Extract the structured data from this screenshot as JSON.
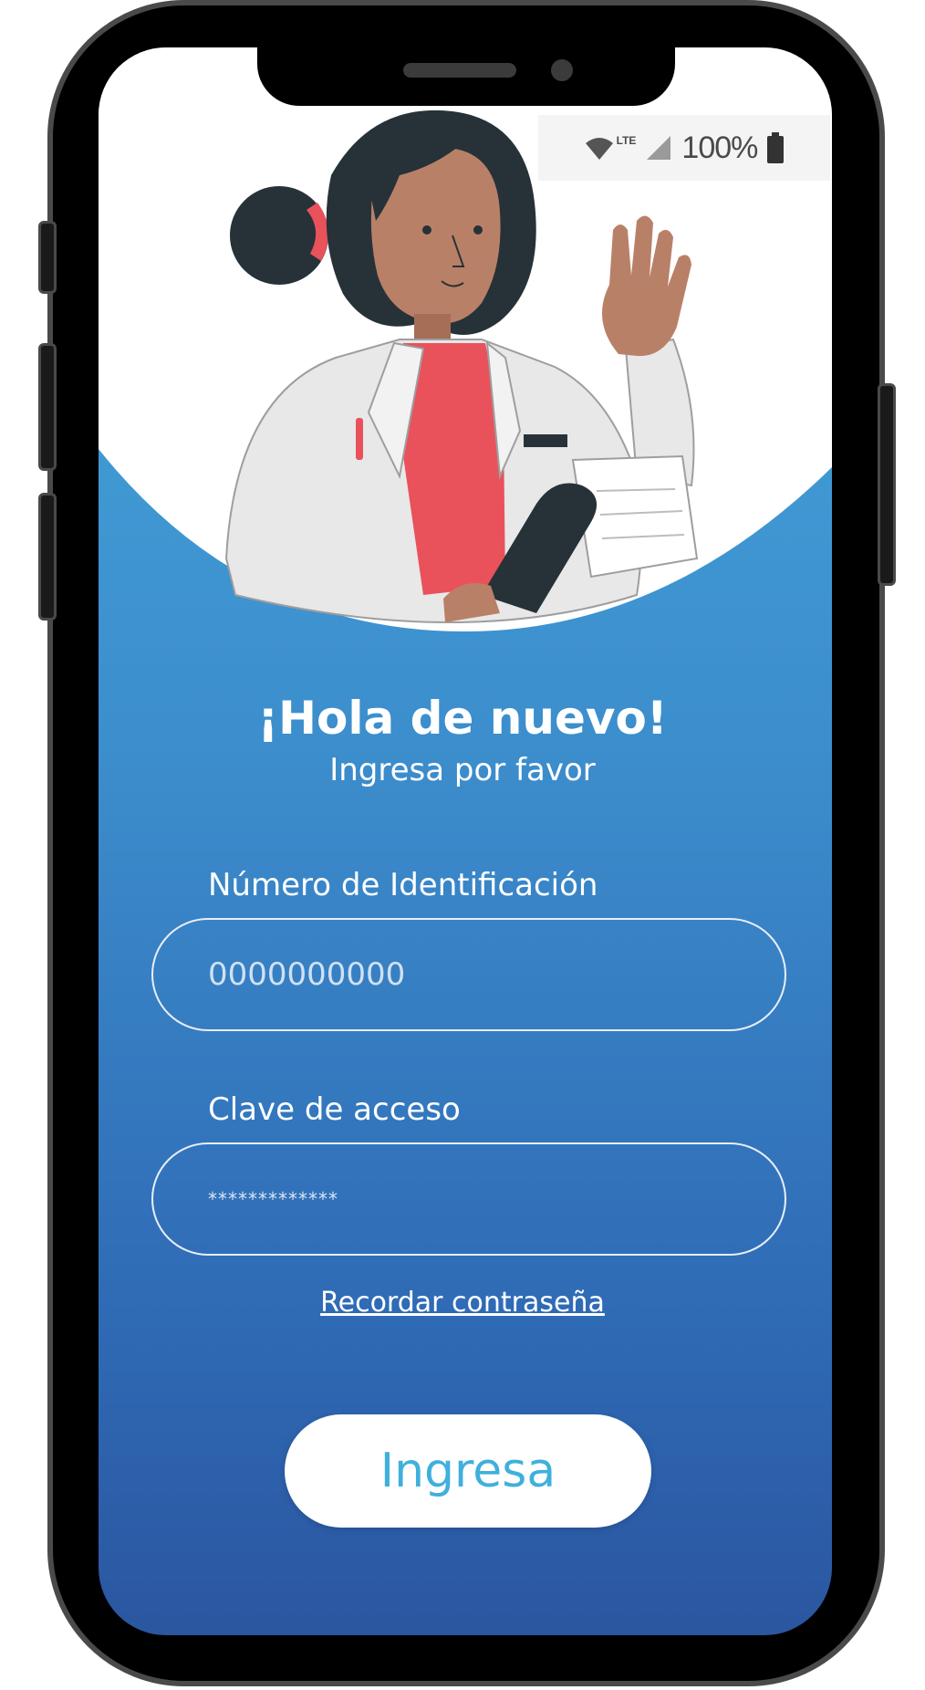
{
  "status_bar": {
    "network_label": "LTE",
    "battery_text": "100%"
  },
  "login": {
    "title": "¡Hola de nuevo!",
    "subtitle": "Ingresa por favor",
    "id_label": "Número de Identificación",
    "id_value": "0000000000",
    "password_label": "Clave de acceso",
    "password_value": "*************",
    "remember_link": "Recordar contraseña",
    "submit_label": "Ingresa"
  },
  "colors": {
    "gradient_top": "#45a8dc",
    "gradient_bottom": "#2b56a0",
    "button_text": "#3fb0dc",
    "shirt": "#e9525b",
    "hair": "#263238",
    "skin": "#b98068"
  },
  "icons": [
    "wifi-icon",
    "signal-icon",
    "battery-icon"
  ]
}
